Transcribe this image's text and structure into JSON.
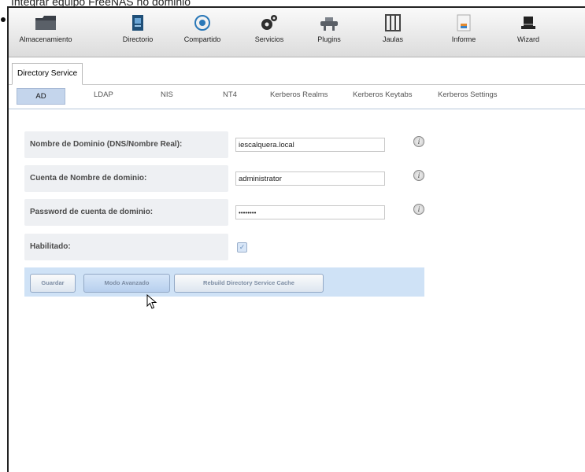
{
  "caption": "Integrar equipo FreeNAS no dominio",
  "toolbar": {
    "items": [
      {
        "label": "Almacenamiento",
        "icon": "folder-icon"
      },
      {
        "label": "Directorio",
        "icon": "directory-icon"
      },
      {
        "label": "Compartido",
        "icon": "share-icon"
      },
      {
        "label": "Servicios",
        "icon": "gears-icon"
      },
      {
        "label": "Plugins",
        "icon": "plugins-icon"
      },
      {
        "label": "Jaulas",
        "icon": "jail-icon"
      },
      {
        "label": "Informe",
        "icon": "report-icon"
      },
      {
        "label": "Wizard",
        "icon": "wizard-hat-icon"
      }
    ]
  },
  "main_tab": "Directory Service",
  "subtabs": [
    "AD",
    "LDAP",
    "NIS",
    "NT4",
    "Kerberos Realms",
    "Kerberos Keytabs",
    "Kerberos Settings"
  ],
  "form": {
    "domain_label": "Nombre de Dominio (DNS/Nombre Real):",
    "domain_value": "iescalquera.local",
    "account_label": "Cuenta de Nombre de dominio:",
    "account_value": "administrator",
    "password_label": "Password de cuenta de dominio:",
    "password_value": "••••••••",
    "enabled_label": "Habilitado:",
    "enabled": true
  },
  "buttons": {
    "save": "Guardar",
    "advanced": "Modo Avanzado",
    "rebuild": "Rebuild Directory Service Cache"
  },
  "colors": {
    "accent": "#c4d5ec",
    "button_bar": "#cfe2f6",
    "label_bg": "#eef0f3"
  }
}
